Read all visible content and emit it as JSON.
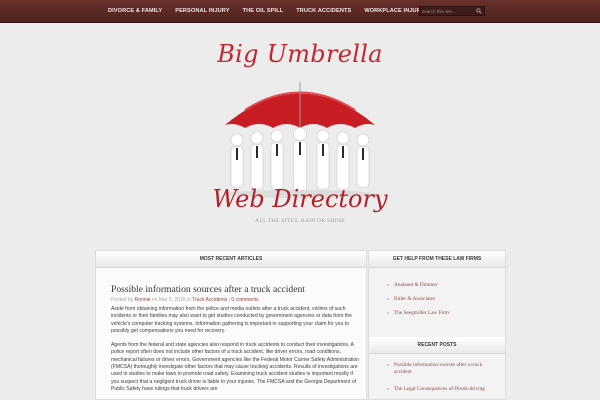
{
  "nav": {
    "items": [
      "DIVORCE & FAMILY",
      "PERSONAL INJURY",
      "THE OIL SPILL",
      "TRUCK ACCIDENTS",
      "WORKPLACE INJURY"
    ],
    "search_placeholder": "search this site..."
  },
  "brand": {
    "title_top": "Big Umbrella",
    "title_bottom": "Web Directory",
    "tagline": "ALL THE SITES, RAIN OR SHINE"
  },
  "main": {
    "heading": "MOST RECENT ARTICLES",
    "post_title": "Possible information sources after a truck accident",
    "meta": {
      "posted_by": "Posted by",
      "author": "Ronnie",
      "on": "on Mar 6, 2016 in",
      "category": "Truck Accidents",
      "sep": "|",
      "comments": "0 comments"
    },
    "paragraphs": [
      "Aside from obtaining information from the police and media outlets after a truck accident, victims of such incidents or their families may also want to get studies conducted by government agencies or data from the vehicle’s computer tracking systems. Information gathering is important in supporting your claim for you to possibly get compensations you need for recovery.",
      "Agents from the federal and state agencies also respond in truck accidents to conduct their investigations. A police report often does not include other factors of a truck accident, like driver errors, road conditions, mechanical failures or driver errors. Government agencies like the Federal Motor Carrier Safety Administration (FMCSA) thoroughly investigate other factors that may cause trucking accidents. Results of investigations are used in studies to make laws to promote road safety. Examining truck accident studies is important mostly if you suspect that a negligent truck driver is liable to your injuries. The FMCSA and the Georgia Department of Public Safety have rulings that truck drivers are"
    ]
  },
  "sidebar": {
    "law_heading": "GET HELP FROM THESE LAW FIRMS",
    "law_firms": [
      "Anaband & Dimmer",
      "Bitler & Associates",
      "The Seegmiller Law Firm"
    ],
    "recent_heading": "RECENT POSTS",
    "recent_posts": [
      "Possible information sources after a truck accident",
      "The Legal Consequences of Drunk-driving"
    ]
  },
  "colors": {
    "nav_bg": "#5b2a25",
    "brand_red": "#c1272d"
  }
}
